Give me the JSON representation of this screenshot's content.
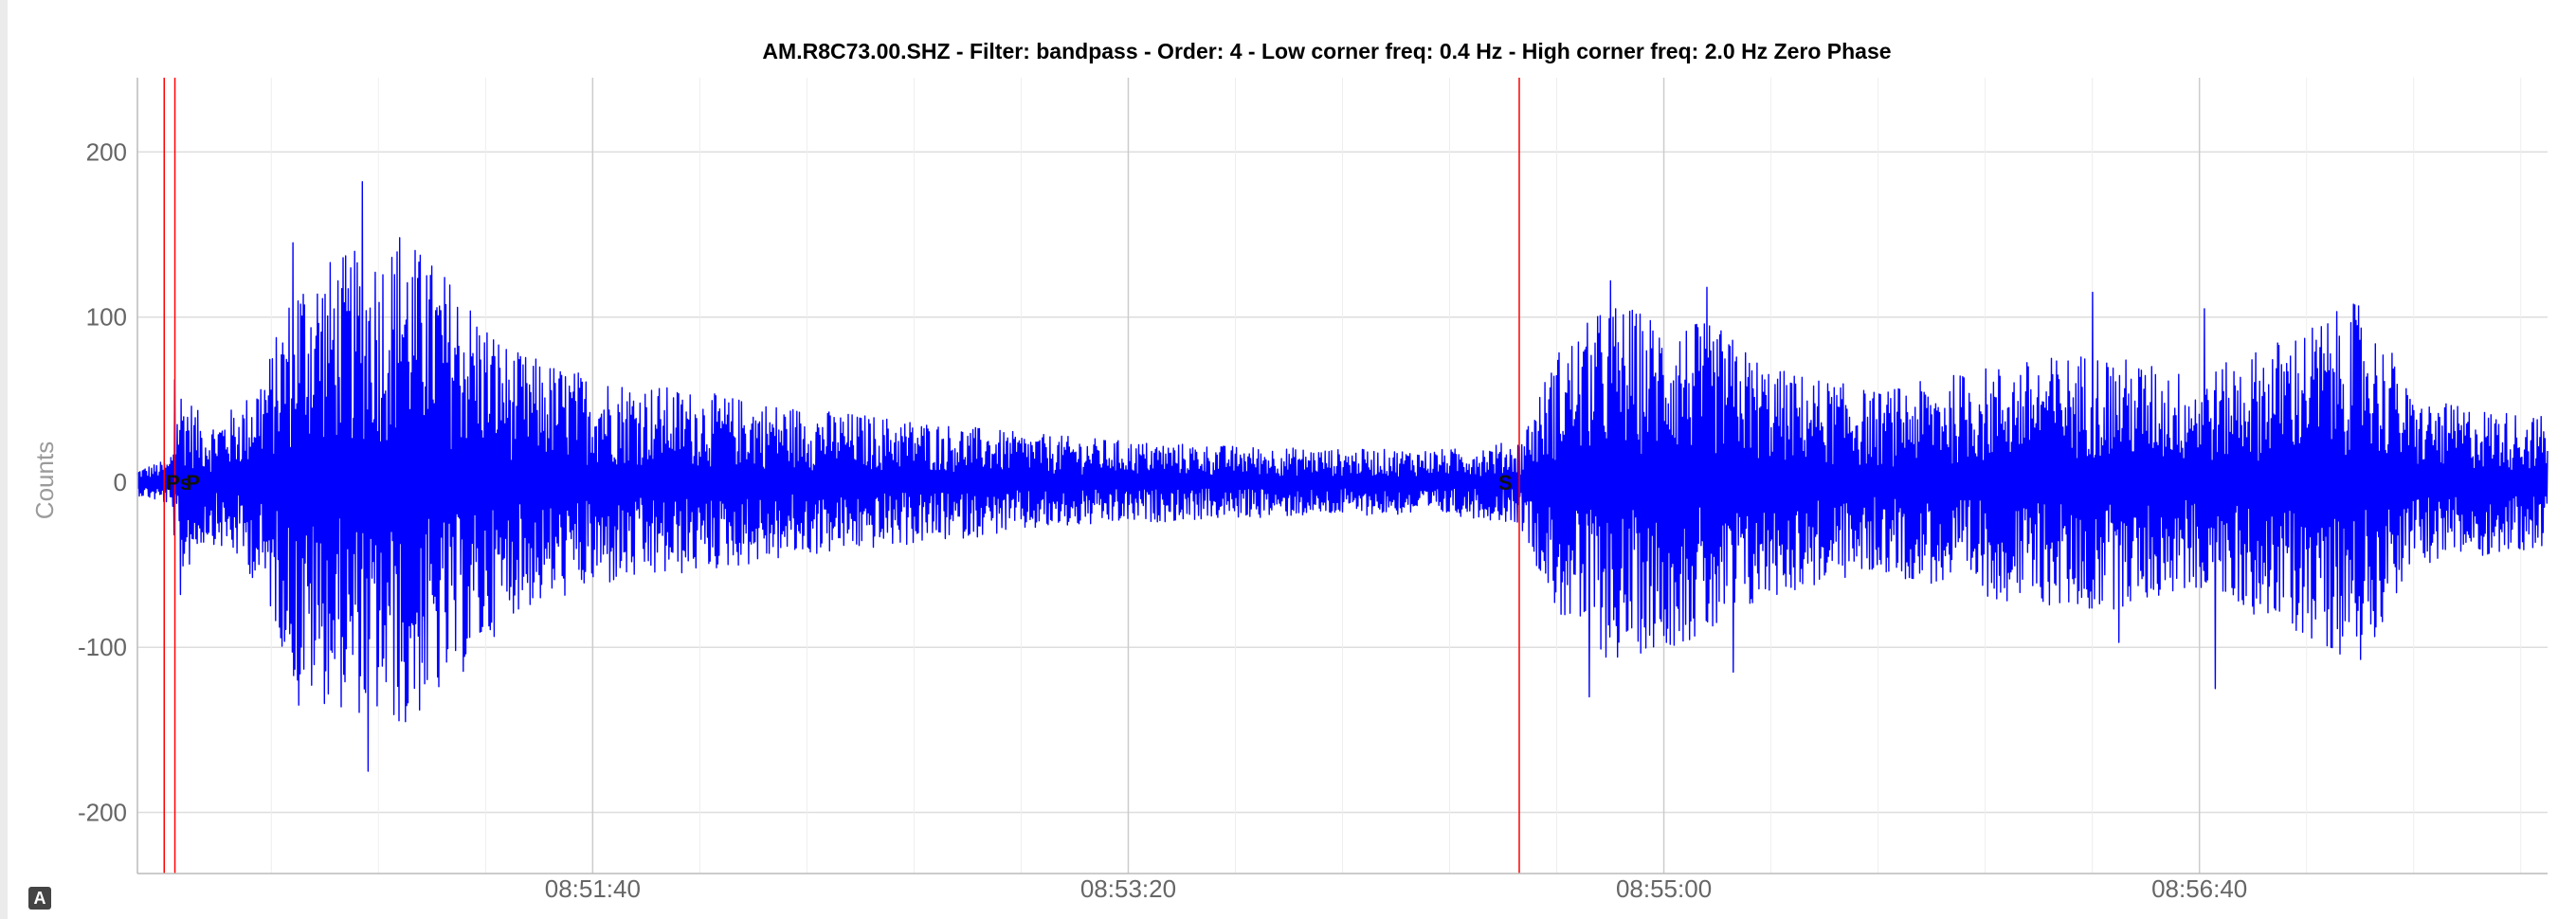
{
  "chart_data": {
    "type": "line",
    "title": "AM.R8C73.00.SHZ - Filter: bandpass - Order: 4 - Low corner freq: 0.4 Hz - High corner freq: 2.0 Hz Zero Phase",
    "xlabel": "",
    "ylabel": "Counts",
    "ylim": [
      -237,
      245
    ],
    "y_ticks": [
      200,
      100,
      0,
      -100,
      -200
    ],
    "y_tick_labels": [
      "200",
      "100",
      "0",
      "-100",
      "-200"
    ],
    "x_start": "08:50:15",
    "x_end": "08:57:45",
    "x_ticks": [
      "08:51:40",
      "08:53:20",
      "08:55:00",
      "08:56:40"
    ],
    "grid": true,
    "series": [
      {
        "color": "#0000ff",
        "envelope": [
          {
            "t": "08:50:15",
            "amp": 8
          },
          {
            "t": "08:50:21",
            "amp": 14
          },
          {
            "t": "08:50:23",
            "amp": 60
          },
          {
            "t": "08:50:28",
            "amp": 35
          },
          {
            "t": "08:50:35",
            "amp": 50
          },
          {
            "t": "08:50:40",
            "amp": 80
          },
          {
            "t": "08:50:45",
            "amp": 130
          },
          {
            "t": "08:50:55",
            "amp": 140
          },
          {
            "t": "08:51:05",
            "amp": 150
          },
          {
            "t": "08:51:15",
            "amp": 120
          },
          {
            "t": "08:51:25",
            "amp": 80
          },
          {
            "t": "08:51:40",
            "amp": 65
          },
          {
            "t": "08:52:00",
            "amp": 55
          },
          {
            "t": "08:52:20",
            "amp": 45
          },
          {
            "t": "08:52:40",
            "amp": 38
          },
          {
            "t": "08:53:00",
            "amp": 30
          },
          {
            "t": "08:53:20",
            "amp": 25
          },
          {
            "t": "08:53:40",
            "amp": 22
          },
          {
            "t": "08:54:00",
            "amp": 20
          },
          {
            "t": "08:54:20",
            "amp": 20
          },
          {
            "t": "08:54:33",
            "amp": 25
          },
          {
            "t": "08:54:40",
            "amp": 80
          },
          {
            "t": "08:54:50",
            "amp": 110
          },
          {
            "t": "08:55:00",
            "amp": 100
          },
          {
            "t": "08:55:10",
            "amp": 95
          },
          {
            "t": "08:55:20",
            "amp": 70
          },
          {
            "t": "08:55:40",
            "amp": 55
          },
          {
            "t": "08:56:00",
            "amp": 70
          },
          {
            "t": "08:56:20",
            "amp": 80
          },
          {
            "t": "08:56:40",
            "amp": 65
          },
          {
            "t": "08:57:00",
            "amp": 95
          },
          {
            "t": "08:57:10",
            "amp": 110
          },
          {
            "t": "08:57:20",
            "amp": 50
          },
          {
            "t": "08:57:45",
            "amp": 40
          }
        ],
        "peaks": [
          {
            "t": "08:50:22",
            "v": 62
          },
          {
            "t": "08:50:23",
            "v": -68
          },
          {
            "t": "08:50:44",
            "v": 145
          },
          {
            "t": "08:50:45",
            "v": -135
          },
          {
            "t": "08:50:57",
            "v": 182
          },
          {
            "t": "08:50:58",
            "v": -175
          },
          {
            "t": "08:51:04",
            "v": 148
          },
          {
            "t": "08:51:05",
            "v": -145
          },
          {
            "t": "08:51:09",
            "v": 125
          },
          {
            "t": "08:51:11",
            "v": -118
          },
          {
            "t": "08:54:50",
            "v": 122
          },
          {
            "t": "08:54:46",
            "v": -130
          },
          {
            "t": "08:55:08",
            "v": 118
          },
          {
            "t": "08:55:13",
            "v": -115
          },
          {
            "t": "08:56:20",
            "v": 115
          },
          {
            "t": "08:56:25",
            "v": -97
          },
          {
            "t": "08:56:41",
            "v": 105
          },
          {
            "t": "08:56:43",
            "v": -125
          },
          {
            "t": "08:57:16",
            "v": 78
          }
        ]
      }
    ],
    "phases": [
      {
        "label": "Ps",
        "t": "08:50:20",
        "color": "#ff0000"
      },
      {
        "label": "P",
        "t": "08:50:22",
        "color": "#ff0000"
      },
      {
        "label": "S",
        "t": "08:54:33",
        "color": "#ff0000"
      }
    ]
  },
  "badge": "A"
}
